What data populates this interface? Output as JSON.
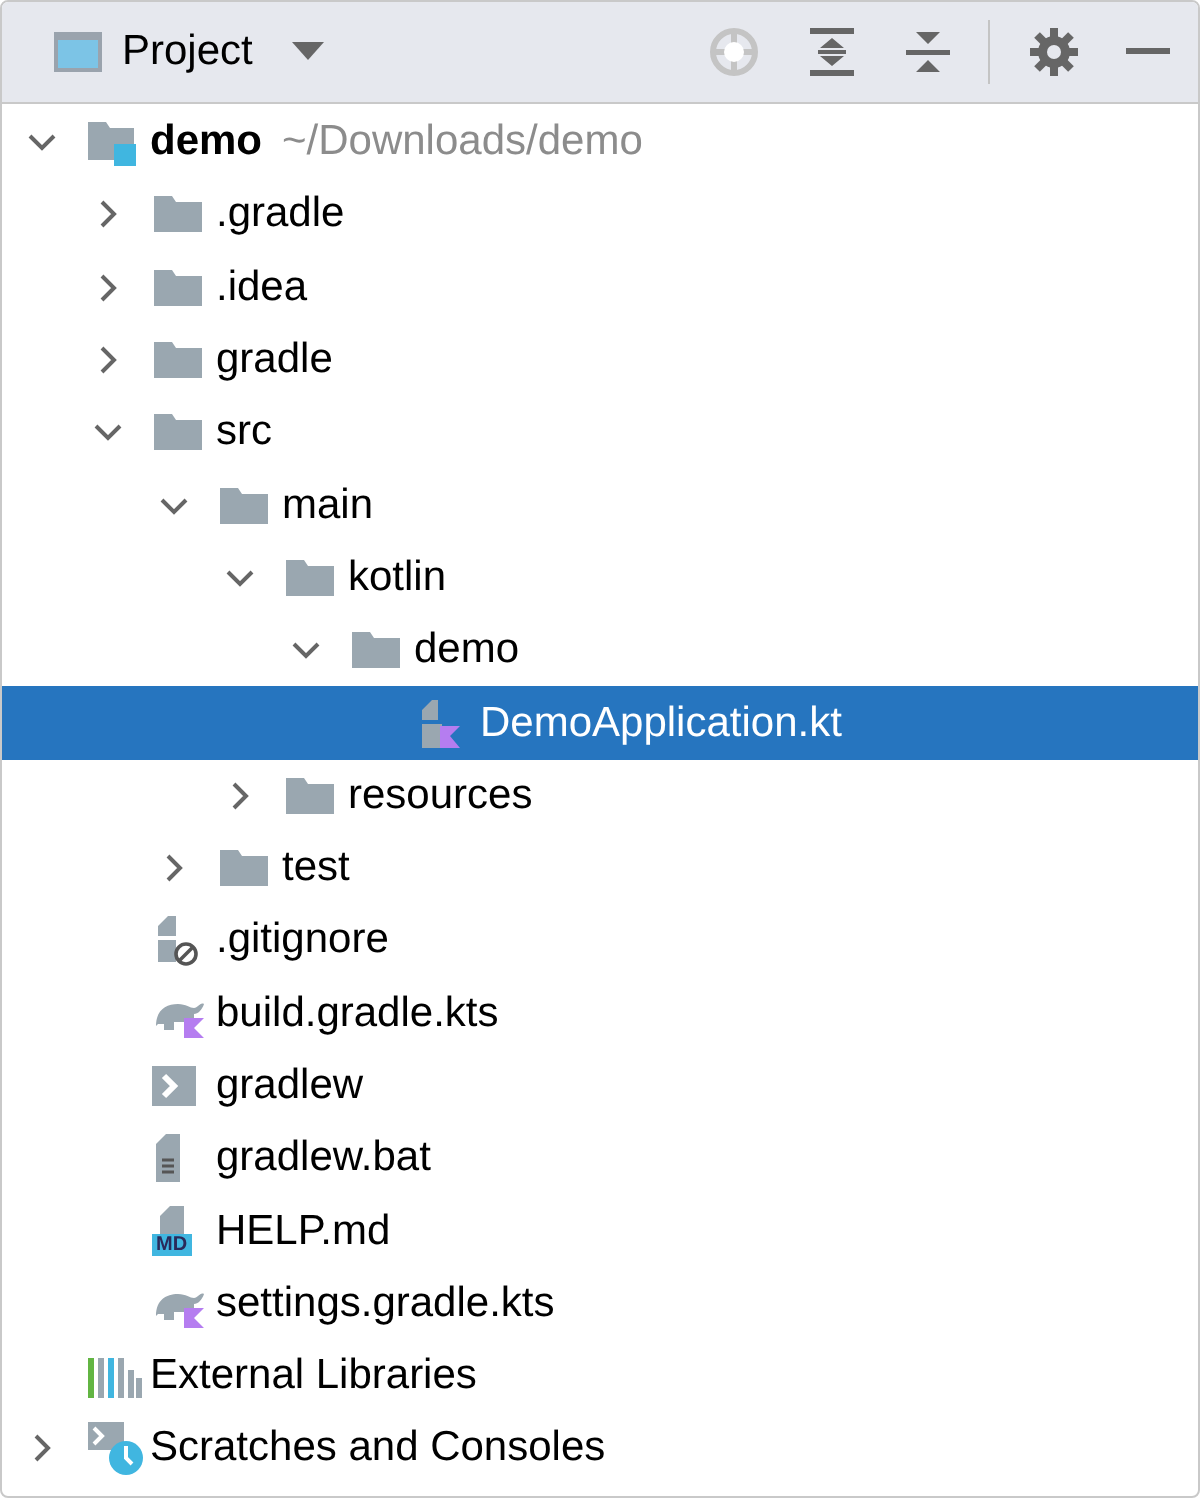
{
  "panel": {
    "title": "Project"
  },
  "tree": [
    {
      "name": "demo",
      "path": "~/Downloads/demo",
      "kind": "module",
      "expanded": true,
      "selected": false,
      "children": [
        {
          "name": ".gradle",
          "kind": "folder",
          "expanded": false,
          "selected": false
        },
        {
          "name": ".idea",
          "kind": "folder",
          "expanded": false,
          "selected": false
        },
        {
          "name": "gradle",
          "kind": "folder",
          "expanded": false,
          "selected": false
        },
        {
          "name": "src",
          "kind": "folder",
          "expanded": true,
          "selected": false,
          "children": [
            {
              "name": "main",
              "kind": "folder",
              "expanded": true,
              "selected": false,
              "children": [
                {
                  "name": "kotlin",
                  "kind": "folder",
                  "expanded": true,
                  "selected": false,
                  "children": [
                    {
                      "name": "demo",
                      "kind": "folder",
                      "expanded": true,
                      "selected": false,
                      "children": [
                        {
                          "name": "DemoApplication.kt",
                          "kind": "kotlin",
                          "selected": true
                        }
                      ]
                    }
                  ]
                },
                {
                  "name": "resources",
                  "kind": "folder",
                  "expanded": false,
                  "selected": false
                }
              ]
            },
            {
              "name": "test",
              "kind": "folder",
              "expanded": false,
              "selected": false
            }
          ]
        },
        {
          "name": ".gitignore",
          "kind": "ignore",
          "selected": false
        },
        {
          "name": "build.gradle.kts",
          "kind": "gradle",
          "selected": false
        },
        {
          "name": "gradlew",
          "kind": "script",
          "selected": false
        },
        {
          "name": "gradlew.bat",
          "kind": "text",
          "selected": false
        },
        {
          "name": "HELP.md",
          "kind": "markdown",
          "icon_label": "MD",
          "selected": false
        },
        {
          "name": "settings.gradle.kts",
          "kind": "gradle",
          "selected": false
        }
      ]
    },
    {
      "name": "External Libraries",
      "kind": "libraries",
      "selected": false
    },
    {
      "name": "Scratches and Consoles",
      "kind": "scratches",
      "expanded": false,
      "selected": false
    }
  ]
}
